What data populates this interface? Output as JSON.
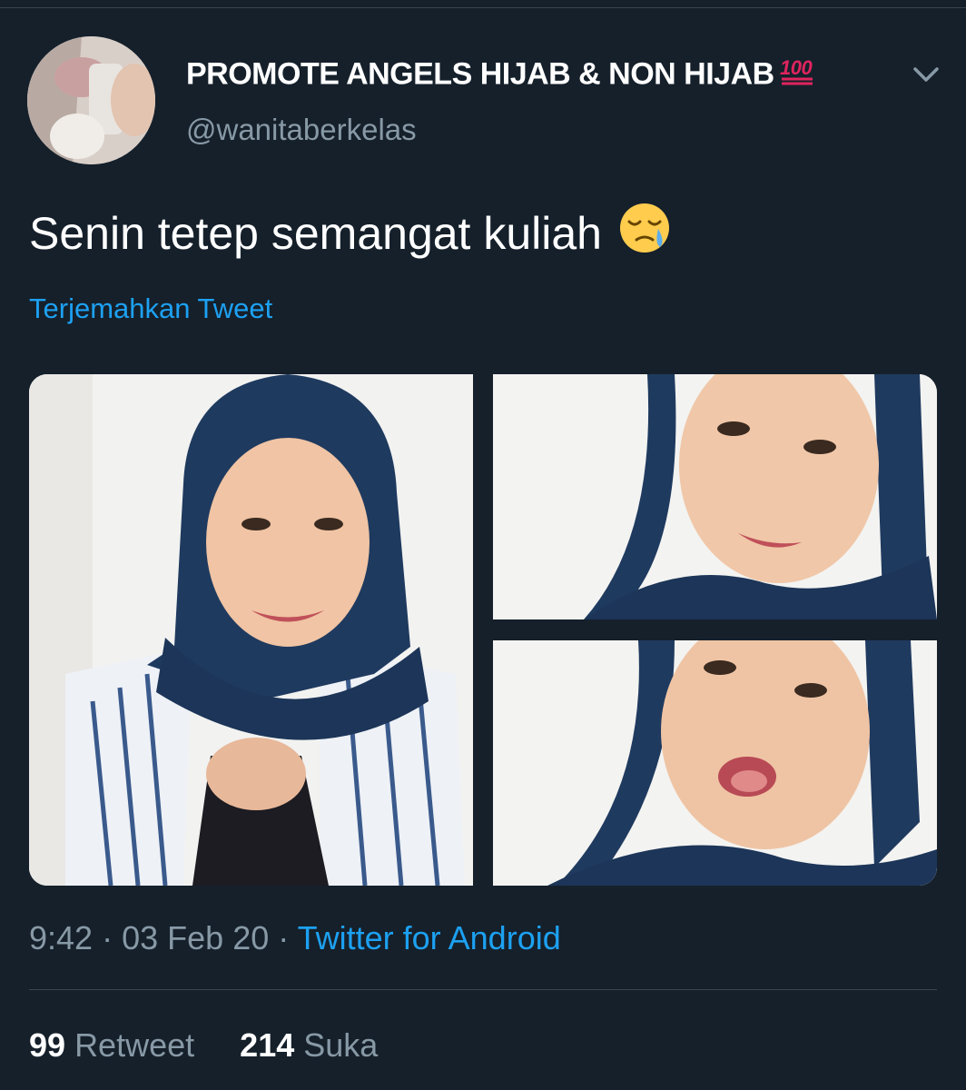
{
  "tweet": {
    "display_name": "PROMOTE ANGELS HIJAB & NON HIJAB",
    "display_name_emoji": "hundred-points-emoji",
    "handle": "@wanitaberkelas",
    "text": "Senin tetep semangat kuliah",
    "text_emoji": "sad-but-relieved-face-emoji",
    "translate_label": "Terjemahkan Tweet",
    "time": "9:42",
    "date": "03 Feb 20",
    "separator": "·",
    "source": "Twitter for Android",
    "retweet_count": "99",
    "retweet_label": "Retweet",
    "like_count": "214",
    "like_label": "Suka",
    "media": [
      {
        "alt": "photo-1"
      },
      {
        "alt": "photo-2"
      },
      {
        "alt": "photo-3"
      }
    ]
  },
  "colors": {
    "background": "#15202b",
    "accent": "#1da1f2",
    "secondary_text": "#8899a6",
    "divider": "#38444d"
  }
}
